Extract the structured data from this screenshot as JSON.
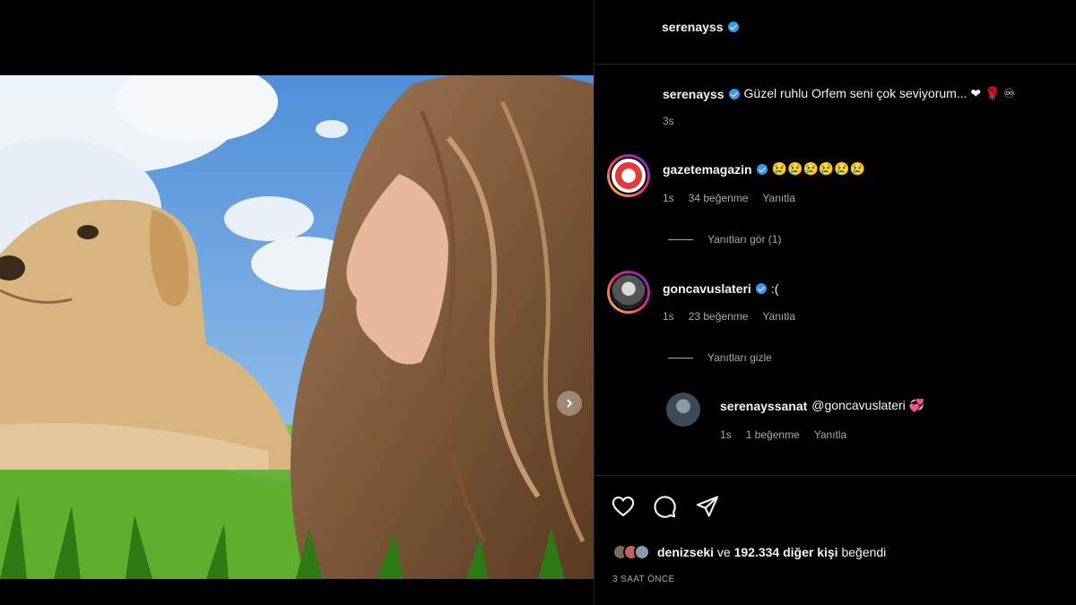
{
  "post": {
    "author": "serenayss",
    "caption_user": "serenayss",
    "caption_text": "Güzel ruhlu Orfem seni çok seviyorum... ❤ 🌹 ♾",
    "caption_time": "3s"
  },
  "comments": [
    {
      "user": "gazetemagazin",
      "text": "😢😢😢😢😢😢",
      "time": "1s",
      "likes": "34 beğenme",
      "reply": "Yanıtla",
      "toggle": "Yanıtları gör (1)"
    },
    {
      "user": "goncavuslateri",
      "text": ":(",
      "time": "1s",
      "likes": "23 beğenme",
      "reply": "Yanıtla",
      "toggle": "Yanıtları gizle"
    }
  ],
  "reply": {
    "user": "serenayssanat",
    "text": "@goncavuslateri 💞",
    "time": "1s",
    "likes": "1 beğenme",
    "reply": "Yanıtla"
  },
  "likes_line": {
    "user": "denizseki",
    "connector": "ve",
    "count_text": "192.334 diğer kişi",
    "suffix": "beğendi"
  },
  "timestamp": "3 SAAT ÖNCE",
  "icons": [
    "heart-icon",
    "comment-icon",
    "share-icon",
    "carousel-next-icon",
    "verified-badge-icon"
  ],
  "colors": {
    "background": "#000000",
    "verified": "#3897f0",
    "muted_text": "#a8a8a8",
    "divider": "#262626"
  }
}
